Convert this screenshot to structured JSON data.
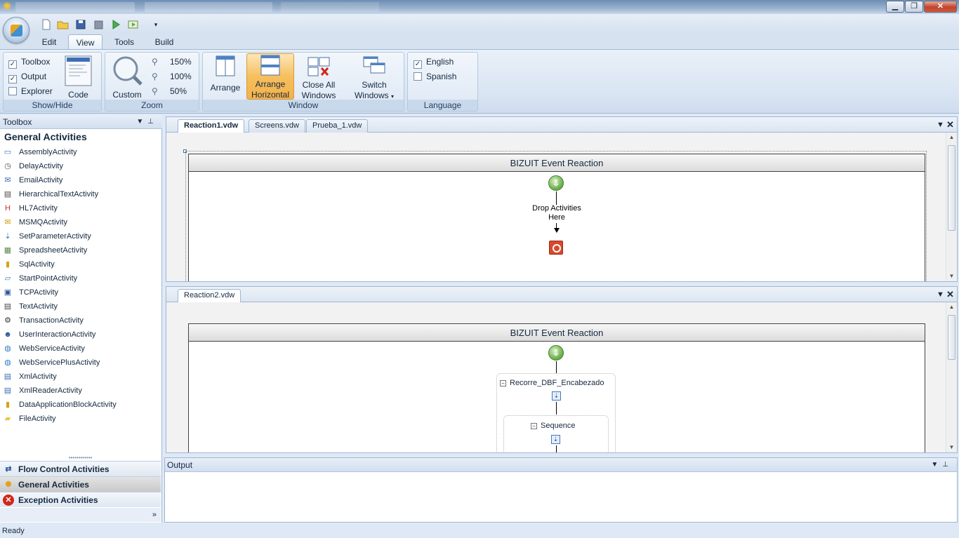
{
  "window": {
    "icon": "app-star-icon",
    "controls": {
      "minimize": "▁",
      "maximize": "❐",
      "close": "✕"
    }
  },
  "ribbon": {
    "tabs": [
      "Edit",
      "View",
      "Tools",
      "Build"
    ],
    "active_tab": "View",
    "groups": {
      "showhide": {
        "label": "Show/Hide",
        "toolbox": "Toolbox",
        "toolbox_checked": true,
        "output": "Output",
        "output_checked": true,
        "explorer": "Explorer",
        "explorer_checked": false,
        "code": "Code"
      },
      "zoom": {
        "label": "Zoom",
        "custom": "Custom",
        "levels": [
          "150%",
          "100%",
          "50%"
        ]
      },
      "window": {
        "label": "Window",
        "arrange": "Arrange",
        "arrange_horizontal_1": "Arrange",
        "arrange_horizontal_2": "Horizontal",
        "close_all_1": "Close All",
        "close_all_2": "Windows",
        "switch_1": "Switch",
        "switch_2": "Windows"
      },
      "language": {
        "label": "Language",
        "english": "English",
        "english_checked": true,
        "spanish": "Spanish",
        "spanish_checked": false
      }
    }
  },
  "toolbox": {
    "title": "Toolbox",
    "section_title": "General Activities",
    "items": [
      {
        "label": "AssemblyActivity",
        "icon": "assembly-icon",
        "glyph": "▭",
        "color": "#3d6fb6"
      },
      {
        "label": "DelayActivity",
        "icon": "clock-icon",
        "glyph": "◷",
        "color": "#4a4a4a"
      },
      {
        "label": "EmailActivity",
        "icon": "email-icon",
        "glyph": "✉",
        "color": "#3d6fb6"
      },
      {
        "label": "HierarchicalTextActivity",
        "icon": "document-icon",
        "glyph": "▤",
        "color": "#4a4a4a"
      },
      {
        "label": "HL7Activity",
        "icon": "hl7-icon",
        "glyph": "H",
        "color": "#c0392b"
      },
      {
        "label": "MSMQActivity",
        "icon": "envelope-icon",
        "glyph": "✉",
        "color": "#c9a000"
      },
      {
        "label": "SetParameterActivity",
        "icon": "set-parameter-icon",
        "glyph": "⇣",
        "color": "#3d6fb6"
      },
      {
        "label": "SpreadsheetActivity",
        "icon": "spreadsheet-icon",
        "glyph": "▦",
        "color": "#5a8a4a"
      },
      {
        "label": "SqlActivity",
        "icon": "database-icon",
        "glyph": "▮",
        "color": "#d9a21b"
      },
      {
        "label": "StartPointActivity",
        "icon": "start-point-icon",
        "glyph": "▱",
        "color": "#3d6fb6"
      },
      {
        "label": "TCPActivity",
        "icon": "network-icon",
        "glyph": "▣",
        "color": "#2c5796"
      },
      {
        "label": "TextActivity",
        "icon": "text-file-icon",
        "glyph": "▤",
        "color": "#4a4a4a"
      },
      {
        "label": "TransactionActivity",
        "icon": "transaction-icon",
        "glyph": "⚙",
        "color": "#333333"
      },
      {
        "label": "UserInteractionActivity",
        "icon": "user-interaction-icon",
        "glyph": "☻",
        "color": "#2c5796"
      },
      {
        "label": "WebServiceActivity",
        "icon": "globe-icon",
        "glyph": "◍",
        "color": "#2f7ec2"
      },
      {
        "label": "WebServicePlusActivity",
        "icon": "globe-plus-icon",
        "glyph": "◍",
        "color": "#2f7ec2"
      },
      {
        "label": "XmlActivity",
        "icon": "xml-icon",
        "glyph": "▤",
        "color": "#3d6fb6"
      },
      {
        "label": "XmlReaderActivity",
        "icon": "xml-reader-icon",
        "glyph": "▤",
        "color": "#3d6fb6"
      },
      {
        "label": "DataApplicationBlockActivity",
        "icon": "database-icon",
        "glyph": "▮",
        "color": "#d9a21b"
      },
      {
        "label": "FileActivity",
        "icon": "folder-icon",
        "glyph": "▰",
        "color": "#e8c44a"
      }
    ],
    "categories": [
      {
        "label": "Flow Control Activities",
        "icon": "flow-control-icon",
        "selected": false
      },
      {
        "label": "General Activities",
        "icon": "general-activities-icon",
        "selected": true
      },
      {
        "label": "Exception Activities",
        "icon": "exception-icon",
        "selected": false
      }
    ]
  },
  "doc1": {
    "tabs": [
      "Reaction1.vdw",
      "Screens.vdw",
      "Prueba_1.vdw"
    ],
    "active_tab": "Reaction1.vdw",
    "workflow_title": "BIZUIT Event Reaction",
    "drop_text_1": "Drop Activities",
    "drop_text_2": "Here"
  },
  "doc2": {
    "tabs": [
      "Reaction2.vdw"
    ],
    "active_tab": "Reaction2.vdw",
    "workflow_title": "BIZUIT Event Reaction",
    "activity": "Recorre_DBF_Encabezado",
    "sequence": "Sequence"
  },
  "output": {
    "title": "Output"
  },
  "status": {
    "text": "Ready"
  },
  "colors": {
    "accent": "#f6bf5e",
    "panel_border": "#9fb7d4",
    "ribbon": "#dfe9f5"
  }
}
